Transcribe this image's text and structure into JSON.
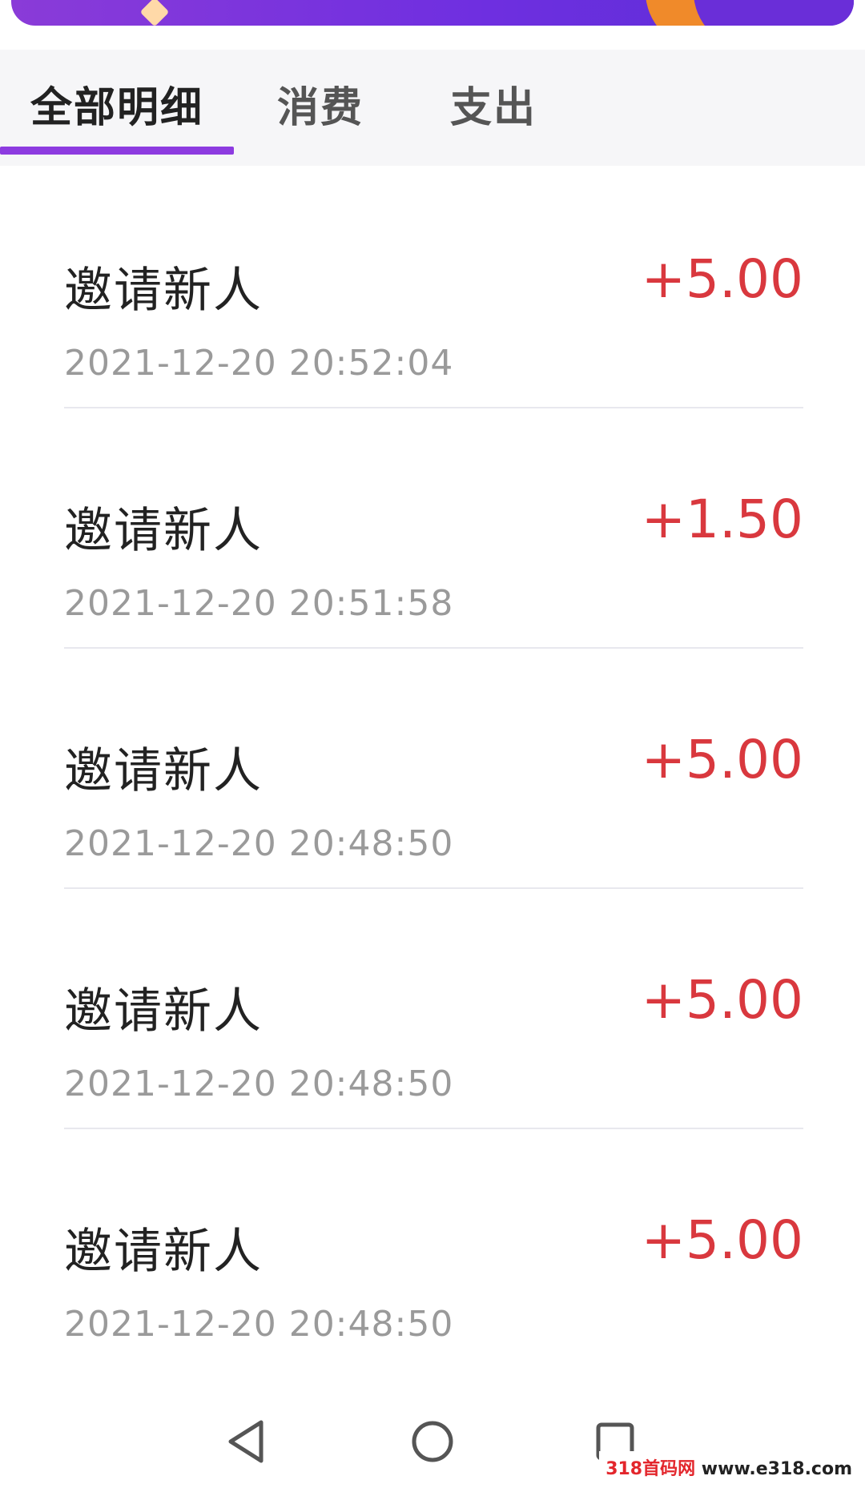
{
  "tabs": [
    {
      "label": "全部明细",
      "active": true
    },
    {
      "label": "消费",
      "active": false
    },
    {
      "label": "支出",
      "active": false
    }
  ],
  "accent_color": "#8d3be0",
  "amount_color": "#d9383e",
  "records": [
    {
      "title": "邀请新人",
      "amount": "+5.00",
      "time": "2021-12-20 20:52:04"
    },
    {
      "title": "邀请新人",
      "amount": "+1.50",
      "time": "2021-12-20 20:51:58"
    },
    {
      "title": "邀请新人",
      "amount": "+5.00",
      "time": "2021-12-20 20:48:50"
    },
    {
      "title": "邀请新人",
      "amount": "+5.00",
      "time": "2021-12-20 20:48:50"
    },
    {
      "title": "邀请新人",
      "amount": "+5.00",
      "time": "2021-12-20 20:48:50"
    }
  ],
  "navbar": {
    "back_icon": "triangle-back-icon",
    "home_icon": "circle-home-icon",
    "recent_icon": "square-recent-icon"
  },
  "watermark": {
    "brand": "318首码网",
    "url": "www.e318.com"
  }
}
